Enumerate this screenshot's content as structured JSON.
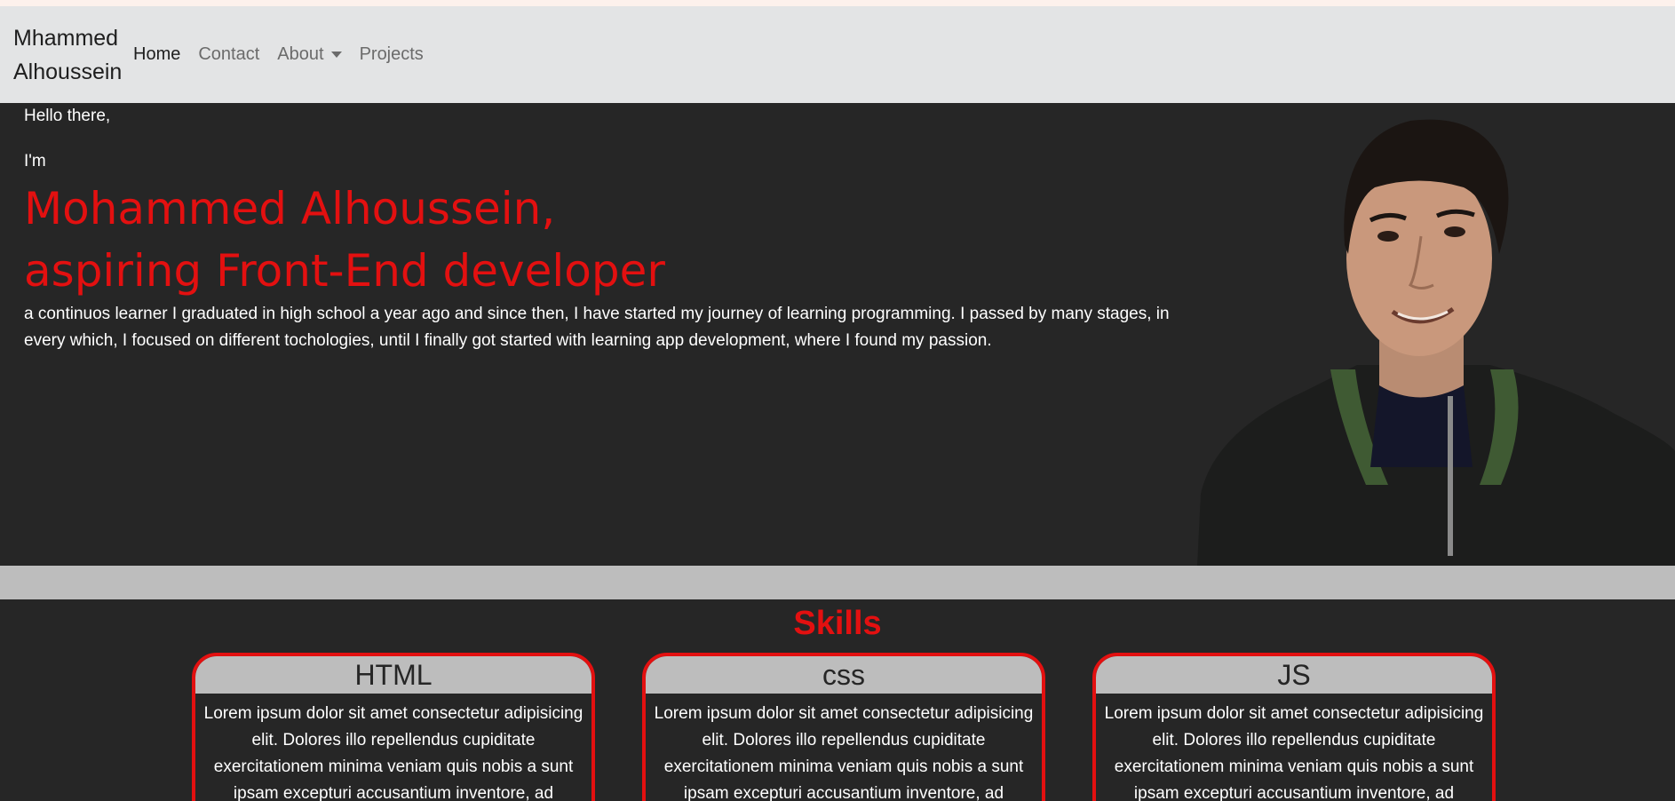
{
  "nav": {
    "brand": "Mhammed Alhoussein",
    "links": [
      {
        "label": "Home"
      },
      {
        "label": "Contact"
      },
      {
        "label": "About"
      },
      {
        "label": "Projects"
      }
    ]
  },
  "hero": {
    "greeting": "Hello there,",
    "im": "I'm",
    "name_line": "Mohammed Alhoussein,",
    "role_line": "aspiring Front-End developer",
    "bio": "a continuos learner I graduated in high school a year ago and since then, I have started my journey of learning programming. I passed by many stages, in every which, I focused on different tochologies, until I finally got started with learning app development, where I found my passion."
  },
  "skills": {
    "title": "Skills",
    "cards": [
      {
        "title": "HTML",
        "text": "Lorem ipsum dolor sit amet consectetur adipisicing elit. Dolores illo repellendus cupiditate exercitationem minima veniam quis nobis a sunt ipsam excepturi accusantium inventore, ad"
      },
      {
        "title": "css",
        "text": "Lorem ipsum dolor sit amet consectetur adipisicing elit. Dolores illo repellendus cupiditate exercitationem minima veniam quis nobis a sunt ipsam excepturi accusantium inventore, ad"
      },
      {
        "title": "JS",
        "text": "Lorem ipsum dolor sit amet consectetur adipisicing elit. Dolores illo repellendus cupiditate exercitationem minima veniam quis nobis a sunt ipsam excepturi accusantium inventore, ad"
      }
    ]
  },
  "colors": {
    "accent": "#e31010",
    "dark_bg": "#262626",
    "navbar_bg": "#e3e4e5",
    "card_head_bg": "#bdbdbd"
  }
}
